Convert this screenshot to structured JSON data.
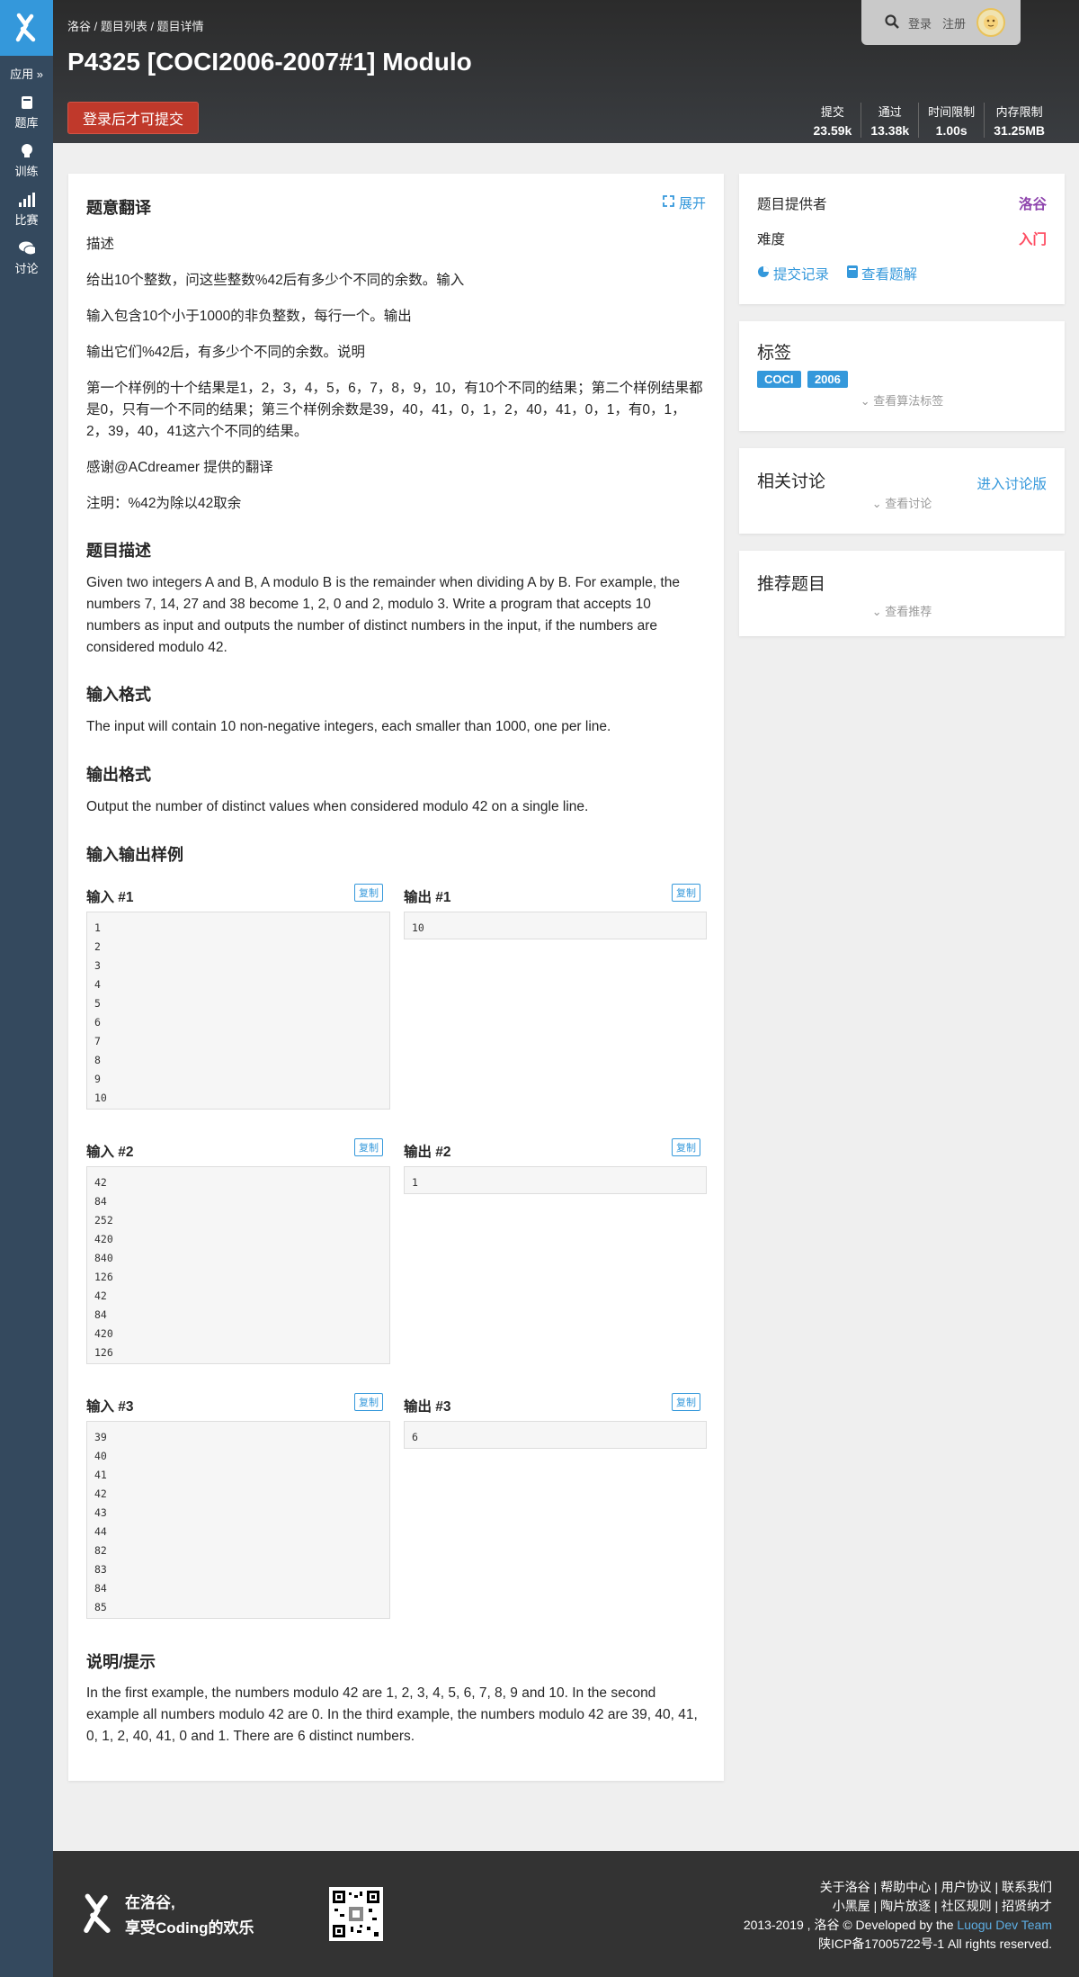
{
  "sidebar": {
    "apps_label": "应用 »",
    "items": [
      {
        "label": "题库",
        "icon": "book-icon"
      },
      {
        "label": "训练",
        "icon": "lightbulb-icon"
      },
      {
        "label": "比赛",
        "icon": "bar-chart-icon"
      },
      {
        "label": "讨论",
        "icon": "chat-icon"
      }
    ]
  },
  "header": {
    "breadcrumb": "洛谷 / 题目列表 / 题目详情",
    "title": "P4325 [COCI2006-2007#1] Modulo",
    "submit_label": "登录后才可提交",
    "login": "登录",
    "register": "注册",
    "stats": [
      {
        "label": "提交",
        "value": "23.59k"
      },
      {
        "label": "通过",
        "value": "13.38k"
      },
      {
        "label": "时间限制",
        "value": "1.00s"
      },
      {
        "label": "内存限制",
        "value": "31.25MB"
      }
    ]
  },
  "main": {
    "translation_title": "题意翻译",
    "expand_label": "展开",
    "translation": [
      "描述",
      "给出10个整数，问这些整数%42后有多少个不同的余数。输入",
      "输入包含10个小于1000的非负整数，每行一个。输出",
      "输出它们%42后，有多少个不同的余数。说明",
      "第一个样例的十个结果是1，2，3，4，5，6，7，8，9，10，有10个不同的结果；第二个样例结果都是0，只有一个不同的结果；第三个样例余数是39，40，41，0，1，2，40，41，0，1，有0，1，2，39，40，41这六个不同的结果。",
      "感谢@ACdreamer 提供的翻译",
      "注明：%42为除以42取余"
    ],
    "desc_title": "题目描述",
    "desc": "Given two integers A and B, A modulo B is the remainder when dividing A by B. For example, the numbers 7, 14, 27 and 38 become 1, 2, 0 and 2, modulo 3. Write a program that accepts 10 numbers as input and outputs the number of distinct numbers in the input, if the numbers are considered modulo 42.",
    "input_title": "输入格式",
    "input_text": "The input will contain 10 non-negative integers, each smaller than 1000, one per line.",
    "output_title": "输出格式",
    "output_text": "Output the number of distinct values when considered modulo 42 on a single line.",
    "samples_title": "输入输出样例",
    "copy_label": "复制",
    "samples": [
      {
        "in_label": "输入 #1",
        "out_label": "输出 #1",
        "input": "1\n2\n3\n4\n5\n6\n7\n8\n9\n10",
        "output": "10"
      },
      {
        "in_label": "输入 #2",
        "out_label": "输出 #2",
        "input": "42\n84\n252\n420\n840\n126\n42\n84\n420\n126",
        "output": "1"
      },
      {
        "in_label": "输入 #3",
        "out_label": "输出 #3",
        "input": "39\n40\n41\n42\n43\n44\n82\n83\n84\n85",
        "output": "6"
      }
    ],
    "hint_title": "说明/提示",
    "hint": "In the first example, the numbers modulo 42 are 1, 2, 3, 4, 5, 6, 7, 8, 9 and 10. In the second example all numbers modulo 42 are 0. In the third example, the numbers modulo 42 are 39, 40, 41, 0, 1, 2, 40, 41, 0 and 1. There are 6 distinct numbers."
  },
  "info": {
    "provider_label": "题目提供者",
    "provider": "洛谷",
    "provider_color": "#8e44ad",
    "difficulty_label": "难度",
    "difficulty": "入门",
    "difficulty_color": "#fe4c61",
    "records_link": "提交记录",
    "solutions_link": "查看题解"
  },
  "tags": {
    "title": "标签",
    "items": [
      "COCI",
      "2006"
    ],
    "more": "查看算法标签"
  },
  "discuss": {
    "title": "相关讨论",
    "link": "进入讨论版",
    "more": "查看讨论"
  },
  "recommend": {
    "title": "推荐题目",
    "more": "查看推荐"
  },
  "footer": {
    "slogan1": "在洛谷,",
    "slogan2": "享受Coding的欢乐",
    "line1": "关于洛谷 | 帮助中心 | 用户协议 | 联系我们",
    "line2": "小黑屋 | 陶片放逐 | 社区规则 | 招贤纳才",
    "line3_prefix": "2013-2019 , 洛谷 © Developed by the ",
    "line3_link": "Luogu Dev Team",
    "line4": "陕ICP备17005722号-1 All rights reserved."
  }
}
